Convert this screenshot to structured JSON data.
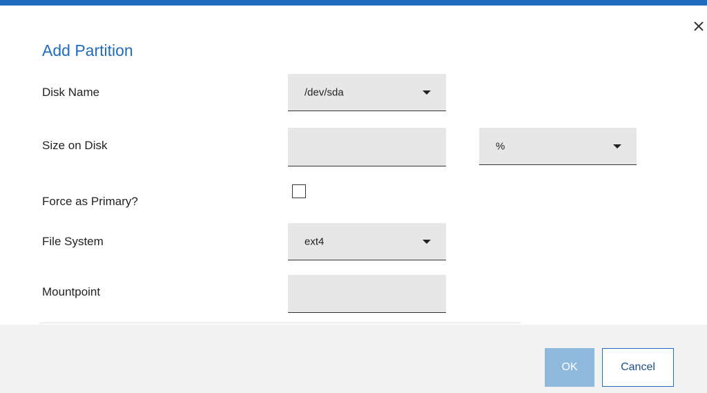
{
  "dialog": {
    "title": "Add Partition",
    "close_icon": "close-icon"
  },
  "form": {
    "disk_name": {
      "label": "Disk Name",
      "value": "/dev/sda"
    },
    "size_on_disk": {
      "label": "Size on Disk",
      "value": "",
      "unit": "%"
    },
    "force_primary": {
      "label": "Force as Primary?",
      "checked": false
    },
    "file_system": {
      "label": "File System",
      "value": "ext4"
    },
    "mountpoint": {
      "label": "Mountpoint",
      "value": ""
    }
  },
  "buttons": {
    "ok": "OK",
    "cancel": "Cancel"
  },
  "colors": {
    "accent": "#1f6bbf",
    "ok_disabled": "#8fb8dd",
    "field_bg": "#e7e7e7",
    "footer_bg": "#f2f2f2"
  }
}
